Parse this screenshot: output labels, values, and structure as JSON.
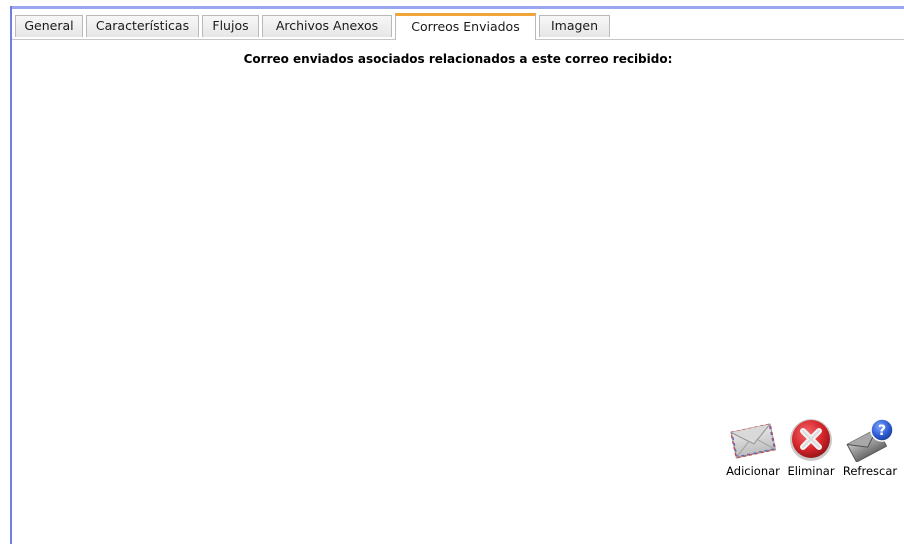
{
  "tabs": [
    {
      "label": "General",
      "active": false
    },
    {
      "label": "Características",
      "active": false
    },
    {
      "label": "Flujos",
      "active": false
    },
    {
      "label": "Archivos Anexos",
      "active": false
    },
    {
      "label": "Correos Enviados",
      "active": true
    },
    {
      "label": "Imagen",
      "active": false
    }
  ],
  "panel": {
    "heading": "Correo enviados asociados relacionados a este correo recibido:"
  },
  "toolbar": {
    "add_label": "Adicionar",
    "add_icon": "envelope-icon",
    "delete_label": "Eliminar",
    "delete_icon": "delete-x-icon",
    "refresh_label": "Refrescar",
    "refresh_icon": "refresh-help-icon"
  },
  "colors": {
    "active_tab_accent": "#f0a43a",
    "delete_red": "#d6252b",
    "help_blue": "#2d5bd1"
  }
}
